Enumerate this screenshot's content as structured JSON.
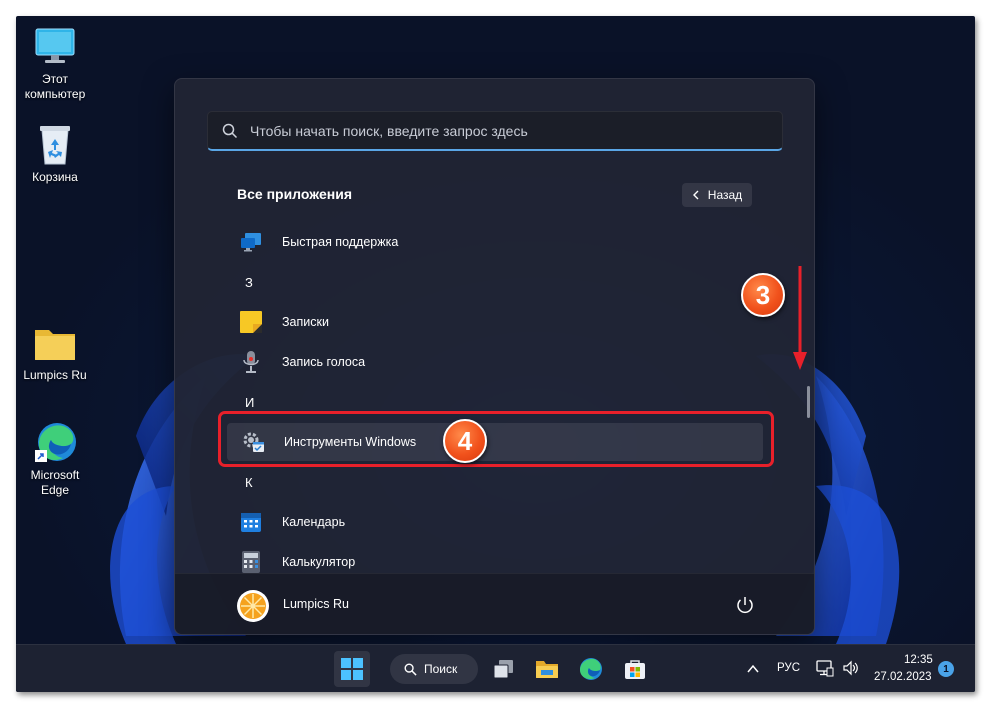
{
  "desktop": {
    "icons": [
      {
        "label": "Этот компьютер",
        "icon": "monitor-icon"
      },
      {
        "label": "Корзина",
        "icon": "recycle-bin-icon"
      },
      {
        "label": "Lumpics Ru",
        "icon": "folder-icon"
      },
      {
        "label": "Microsoft Edge",
        "icon": "edge-icon"
      }
    ]
  },
  "start_menu": {
    "search_placeholder": "Чтобы начать поиск, введите запрос здесь",
    "section_title": "Все приложения",
    "back_label": "Назад",
    "items": [
      {
        "label": "Быстрая поддержка",
        "icon": "quick-assist-icon"
      },
      {
        "letter": "З"
      },
      {
        "label": "Записки",
        "icon": "sticky-notes-icon"
      },
      {
        "label": "Запись голоса",
        "icon": "voice-recorder-icon"
      },
      {
        "letter": "И"
      },
      {
        "label": "Инструменты Windows",
        "icon": "windows-tools-icon",
        "selected": true
      },
      {
        "letter": "К"
      },
      {
        "label": "Календарь",
        "icon": "calendar-icon"
      },
      {
        "label": "Калькулятор",
        "icon": "calculator-icon"
      }
    ],
    "user_name": "Lumpics Ru"
  },
  "annotations": {
    "step_scroll": "3",
    "step_select": "4",
    "accent_color": "#e8202a",
    "badge_color": "#f1521c"
  },
  "taskbar": {
    "search_label": "Поиск",
    "pinned": [
      "start-icon",
      "search-icon",
      "task-view-icon",
      "file-explorer-icon",
      "edge-icon",
      "store-icon"
    ],
    "language": "РУС",
    "time": "12:35",
    "date": "27.02.2023",
    "notification_count": "1"
  }
}
